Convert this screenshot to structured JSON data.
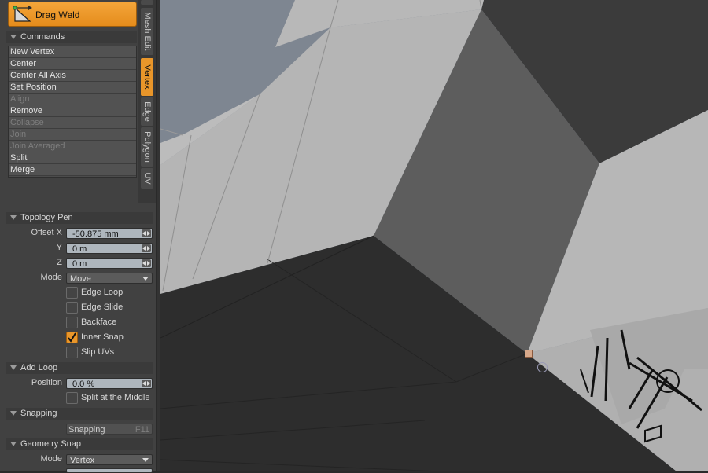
{
  "toolbar": {
    "drag_weld_label": "Drag Weld",
    "colors": {
      "active_orange": "#e9962a",
      "panel_bg": "#414141",
      "field_bg": "#aeb6bd"
    }
  },
  "commands": {
    "header": "Commands",
    "items": [
      {
        "label": "New Vertex",
        "enabled": true
      },
      {
        "label": "Center",
        "enabled": true
      },
      {
        "label": "Center All Axis",
        "enabled": true
      },
      {
        "label": "Set Position",
        "enabled": true
      },
      {
        "label": "Align",
        "enabled": false
      },
      {
        "label": "Remove",
        "enabled": true
      },
      {
        "label": "Collapse",
        "enabled": false
      },
      {
        "label": "Join",
        "enabled": false
      },
      {
        "label": "Join Averaged",
        "enabled": false
      },
      {
        "label": "Split",
        "enabled": true
      },
      {
        "label": "Merge",
        "enabled": true
      }
    ]
  },
  "vertical_tabs": [
    {
      "label": "Mesh Edit",
      "active": false
    },
    {
      "label": "Vertex",
      "active": true
    },
    {
      "label": "Edge",
      "active": false
    },
    {
      "label": "Polygon",
      "active": false
    },
    {
      "label": "UV",
      "active": false
    }
  ],
  "topology_pen": {
    "header": "Topology Pen",
    "offset_x_label": "Offset X",
    "offset_x_value": "-50.875 mm",
    "y_label": "Y",
    "y_value": "0 m",
    "z_label": "Z",
    "z_value": "0 m",
    "mode_label": "Mode",
    "mode_value": "Move",
    "checkboxes": [
      {
        "label": "Edge Loop",
        "checked": false
      },
      {
        "label": "Edge Slide",
        "checked": false
      },
      {
        "label": "Backface",
        "checked": false
      },
      {
        "label": "Inner Snap",
        "checked": true
      },
      {
        "label": "Slip UVs",
        "checked": false
      }
    ]
  },
  "add_loop": {
    "header": "Add Loop",
    "position_label": "Position",
    "position_value": "0.0 %",
    "split_middle_label": "Split at the Middle",
    "split_middle_checked": false
  },
  "snapping": {
    "header": "Snapping",
    "button_label": "Snapping",
    "button_key": "F11"
  },
  "geometry_snap": {
    "header": "Geometry Snap",
    "mode_label": "Mode",
    "mode_value": "Vertex"
  },
  "viewport": {
    "icon": "selected-vertex-marker"
  }
}
